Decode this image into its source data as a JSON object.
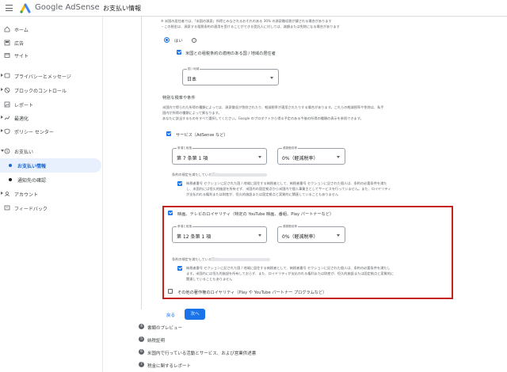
{
  "app": {
    "brand_google": "Google",
    "brand_product": "AdSense",
    "page_title": "お支払い情報"
  },
  "sidebar": {
    "items": [
      {
        "label": "ホーム",
        "icon": "home-icon"
      },
      {
        "label": "広告",
        "icon": "ads-icon"
      },
      {
        "label": "サイト",
        "icon": "sites-icon"
      },
      {
        "label": "プライバシーとメッセージ",
        "icon": "privacy-icon"
      },
      {
        "label": "ブロックのコントロール",
        "icon": "block-icon"
      },
      {
        "label": "レポート",
        "icon": "reports-icon"
      },
      {
        "label": "最適化",
        "icon": "optimize-icon"
      },
      {
        "label": "ポリシー センター",
        "icon": "policy-icon"
      },
      {
        "label": "お支払い",
        "icon": "payments-icon"
      },
      {
        "label": "お支払い情報",
        "icon": "dot-icon"
      },
      {
        "label": "通知先の確認",
        "icon": "dot-icon"
      },
      {
        "label": "アカウント",
        "icon": "account-icon"
      },
      {
        "label": "フィードバック",
        "icon": "feedback-icon"
      }
    ]
  },
  "form": {
    "note_line1": "※ 米国の居住者では、「米国の源泉」所得とみなされるおそれのある 30% の源泉徴収税が課される場合があります",
    "note_line2": "・この税金は、源泉する租税条約の適用を受けることができる受託人に対しては、減額または免除になる場合があります",
    "radio_yes": "はい",
    "treaty_checkbox": "米国との租税条約の適用のある国 / 地域の居住者",
    "country_field_label": "国 / 地域",
    "country_value": "日本",
    "section_heading": "特別な税率や条件",
    "desc_line1": "米国内で得られた所得の種類によっては、源泉徴収が免除されたり、軽減税率が適用されたりする場合があります。これらの軽減税率や免除は、私手",
    "desc_line2": "国内が所得の種類によって異なります。",
    "desc_line3": "あなたに該当するものをすべて選択してください。Google のプロダクトから得る予定のある今後の所得の種類の表示を参照できます。",
    "services": {
      "checkbox_label": "サービス（AdSense など）",
      "article_label": "条項と段落",
      "article_value": "第 7 条第 1 項",
      "rate_label": "源泉徴収率",
      "rate_value": "0%（軽減税率）",
      "reason_label": "条約の規定を満たしている理由",
      "reason_line1": "納税者番号 セクションに記された国 / 地域に居住する納税者として、納税者番号 セクションに記された個人は、条約の必要条件を満た",
      "reason_line2": "し、米国内には恒久的施設を所有せず、米国内の固定拠点から米国内で個人事業主としてサービスを行っていません。また、ロイヤリティ",
      "reason_line3": "が支払われる権利または財産が、恒久的施設または固定拠点と実質的に関連していることもありません"
    },
    "royalty": {
      "checkbox_label": "映画、テレビのロイヤリティ（特定の YouTube 映画、番組、Play パートナーなど）",
      "article_label": "条項と段落",
      "article_value": "第 12 条第 1 項",
      "rate_label": "源泉徴収率",
      "rate_value": "0%（軽減税率）",
      "reason_label": "条約の規定を満たしている理由",
      "reason_line1": "納税者番号 セクションに記された国 / 地域に居住する納税者として、納税者番号 セクションに記された個人は、条約の必要条件を満たし",
      "reason_line2": "ます。米国内には恒久的施設を所有しておらず、また、ロイヤリティが支払われる権利または財産が、恒久的施設または固定拠点と実質的に",
      "reason_line3": "関連していることもありません"
    },
    "other_checkbox": "その他の著作権のロイヤリティ（Play や YouTube パートナー プログラムなど）",
    "back_label": "戻る",
    "next_label": "次へ"
  },
  "steps": [
    {
      "num": "4",
      "label": "書類のプレビュー"
    },
    {
      "num": "5",
      "label": "納税証明"
    },
    {
      "num": "6",
      "label": "米国内で行っている活動とサービス、および営業供述書"
    },
    {
      "num": "7",
      "label": "税金に関するレポート"
    }
  ],
  "colors": {
    "accent": "#1a73e8",
    "highlight_border": "#c5221f",
    "active_nav_bg": "#e8f0fe"
  }
}
